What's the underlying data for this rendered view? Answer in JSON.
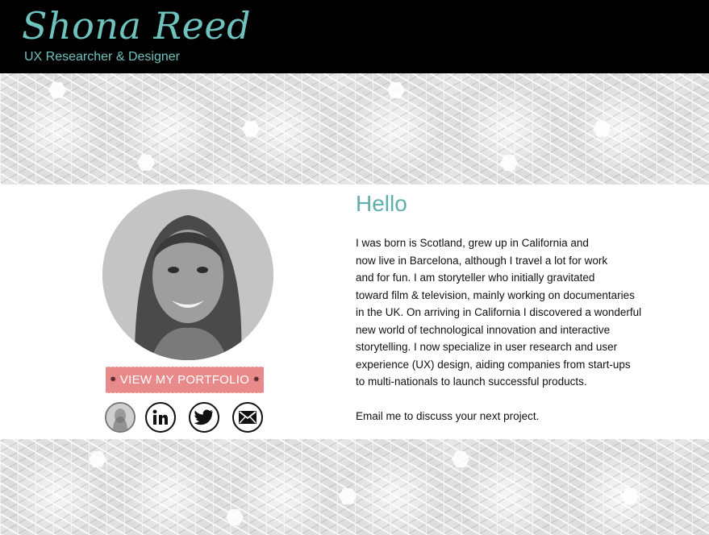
{
  "header": {
    "name": "Shona Reed",
    "tagline": "UX Researcher & Designer"
  },
  "profile": {
    "portfolio_button": "VIEW MY PORTFOLIO",
    "social_icons": [
      "profile-photo-icon",
      "linkedin-icon",
      "twitter-icon",
      "email-icon"
    ]
  },
  "main": {
    "heading": "Hello",
    "bio_lines": [
      "I was born is Scotland, grew up in California and",
      "now live in Barcelona, although I travel a lot for work",
      "and for  fun. I am storyteller who initially gravitated",
      "toward film & television, mainly working on documentaries",
      "in the UK. On arriving in California I discovered a wonderful",
      "new world of technological innovation and interactive",
      "storytelling. I now specialize in user research and user",
      "experience (UX) design, aiding companies from start-ups",
      "to multi-nationals to launch successful products."
    ],
    "email_cta": "Email me to discuss your next project."
  },
  "colors": {
    "brand": "#6fc3bf",
    "heading": "#5fb0aa",
    "button": "#e88a8a",
    "header_bg": "#000000"
  }
}
